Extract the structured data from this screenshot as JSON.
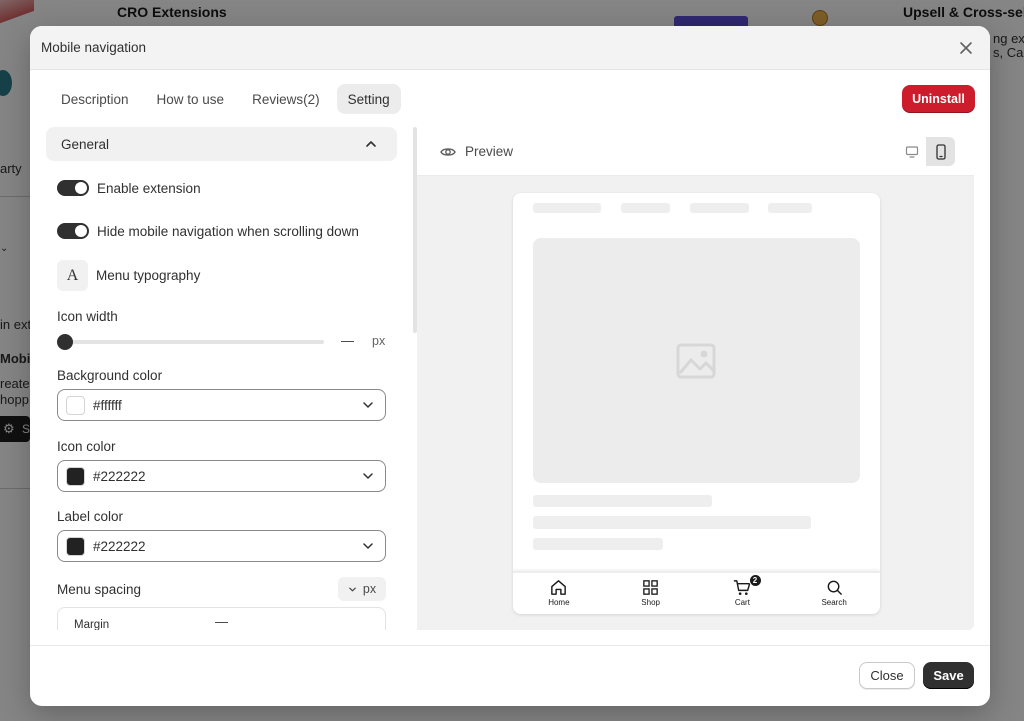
{
  "background": {
    "card1_title": "CRO Extensions",
    "card2_title": "Upsell & Cross-sell",
    "fragments": {
      "right1": "ng ext",
      "right2": "s, Car",
      "left_party": "arty",
      "left_ext": "in ext",
      "left_mobile": "Mobile",
      "left_create": "reate",
      "left_shop": "hopp",
      "left_settings": "S"
    }
  },
  "modal": {
    "title": "Mobile navigation",
    "tabs": [
      {
        "label": "Description"
      },
      {
        "label": "How to use"
      },
      {
        "label": "Reviews(2)"
      },
      {
        "label": "Setting",
        "active": true
      }
    ],
    "uninstall_label": "Uninstall",
    "uninstall_color": "#cd1d2c"
  },
  "settings": {
    "section_title": "General",
    "enable_extension": {
      "label": "Enable extension",
      "on": true
    },
    "hide_on_scroll": {
      "label": "Hide mobile navigation when scrolling down",
      "on": true
    },
    "typography": {
      "label": "Menu typography",
      "icon_glyph": "A"
    },
    "icon_width": {
      "label": "Icon width",
      "value": "—",
      "unit": "px"
    },
    "background_color": {
      "label": "Background color",
      "value": "#ffffff"
    },
    "icon_color": {
      "label": "Icon color",
      "value": "#222222"
    },
    "label_color": {
      "label": "Label color",
      "value": "#222222"
    },
    "menu_spacing": {
      "label": "Menu spacing",
      "unit": "px"
    },
    "margin": {
      "label": "Margin",
      "value": "—"
    }
  },
  "preview": {
    "title": "Preview",
    "device_options": [
      "desktop-icon",
      "mobile-icon"
    ],
    "active_device": "mobile",
    "nav_items": [
      {
        "label": "Home",
        "icon": "home-icon"
      },
      {
        "label": "Shop",
        "icon": "grid-icon"
      },
      {
        "label": "Cart",
        "icon": "cart-icon",
        "badge": "2"
      },
      {
        "label": "Search",
        "icon": "search-icon"
      }
    ]
  },
  "footer": {
    "close_label": "Close",
    "save_label": "Save"
  }
}
